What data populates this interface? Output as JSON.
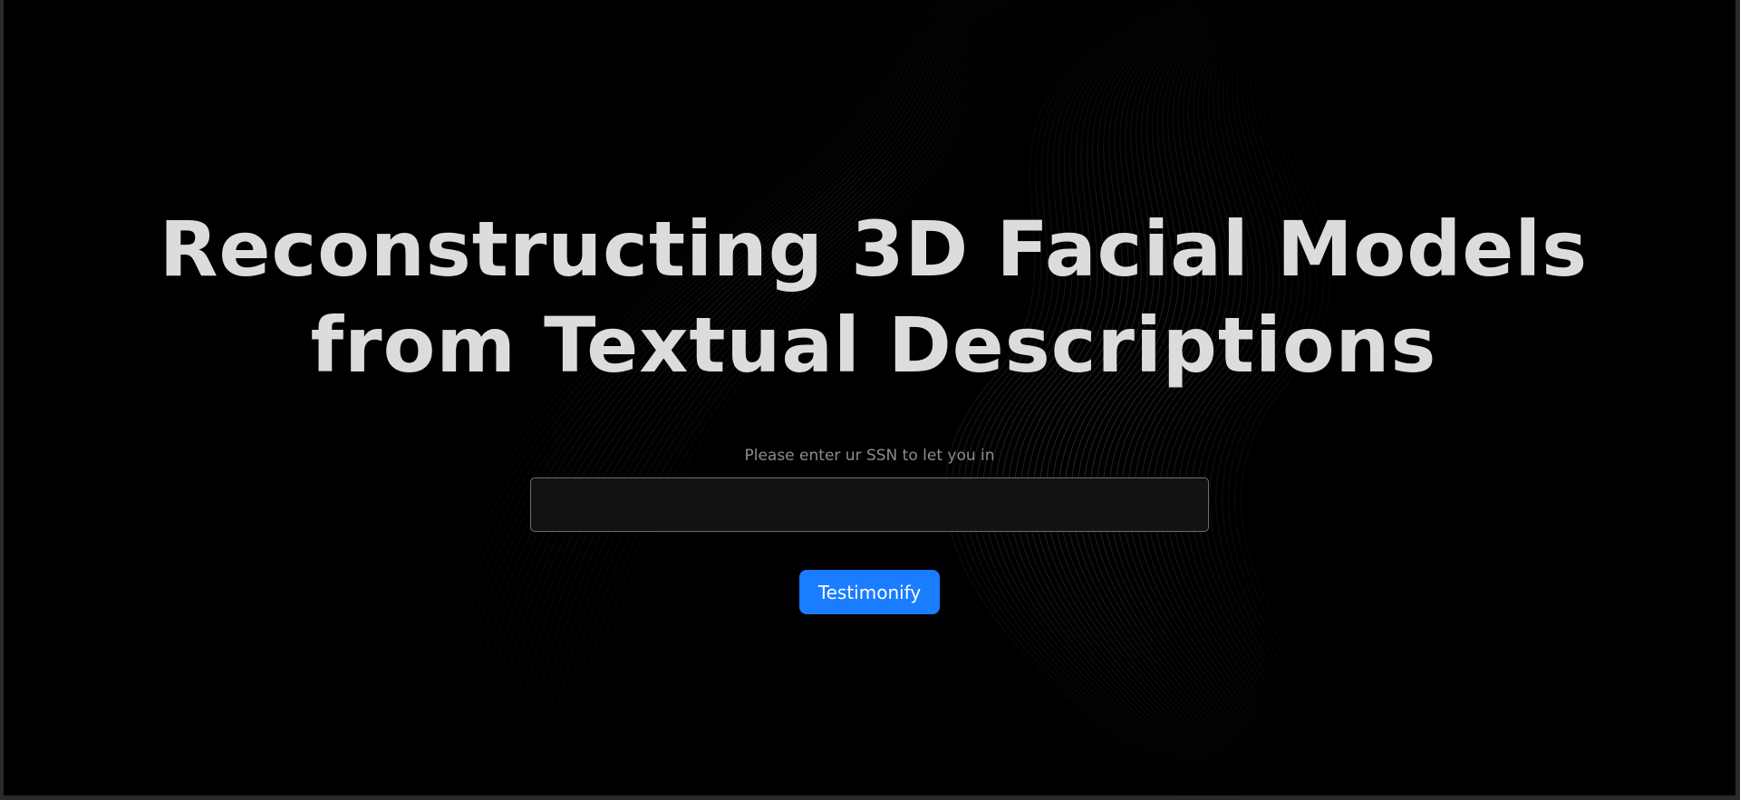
{
  "hero": {
    "title": "Reconstructing 3D Facial Models from Textual Descriptions",
    "prompt": "Please enter ur SSN to let you in",
    "input_value": "",
    "input_placeholder": "",
    "button_label": "Testimonify"
  },
  "colors": {
    "background": "#000000",
    "title_text": "#dcdcdc",
    "prompt_text": "#8c8c8c",
    "input_background": "#121212",
    "input_border": "#6f6f6f",
    "button_background": "#1a7cff",
    "button_text": "#ffffff"
  }
}
